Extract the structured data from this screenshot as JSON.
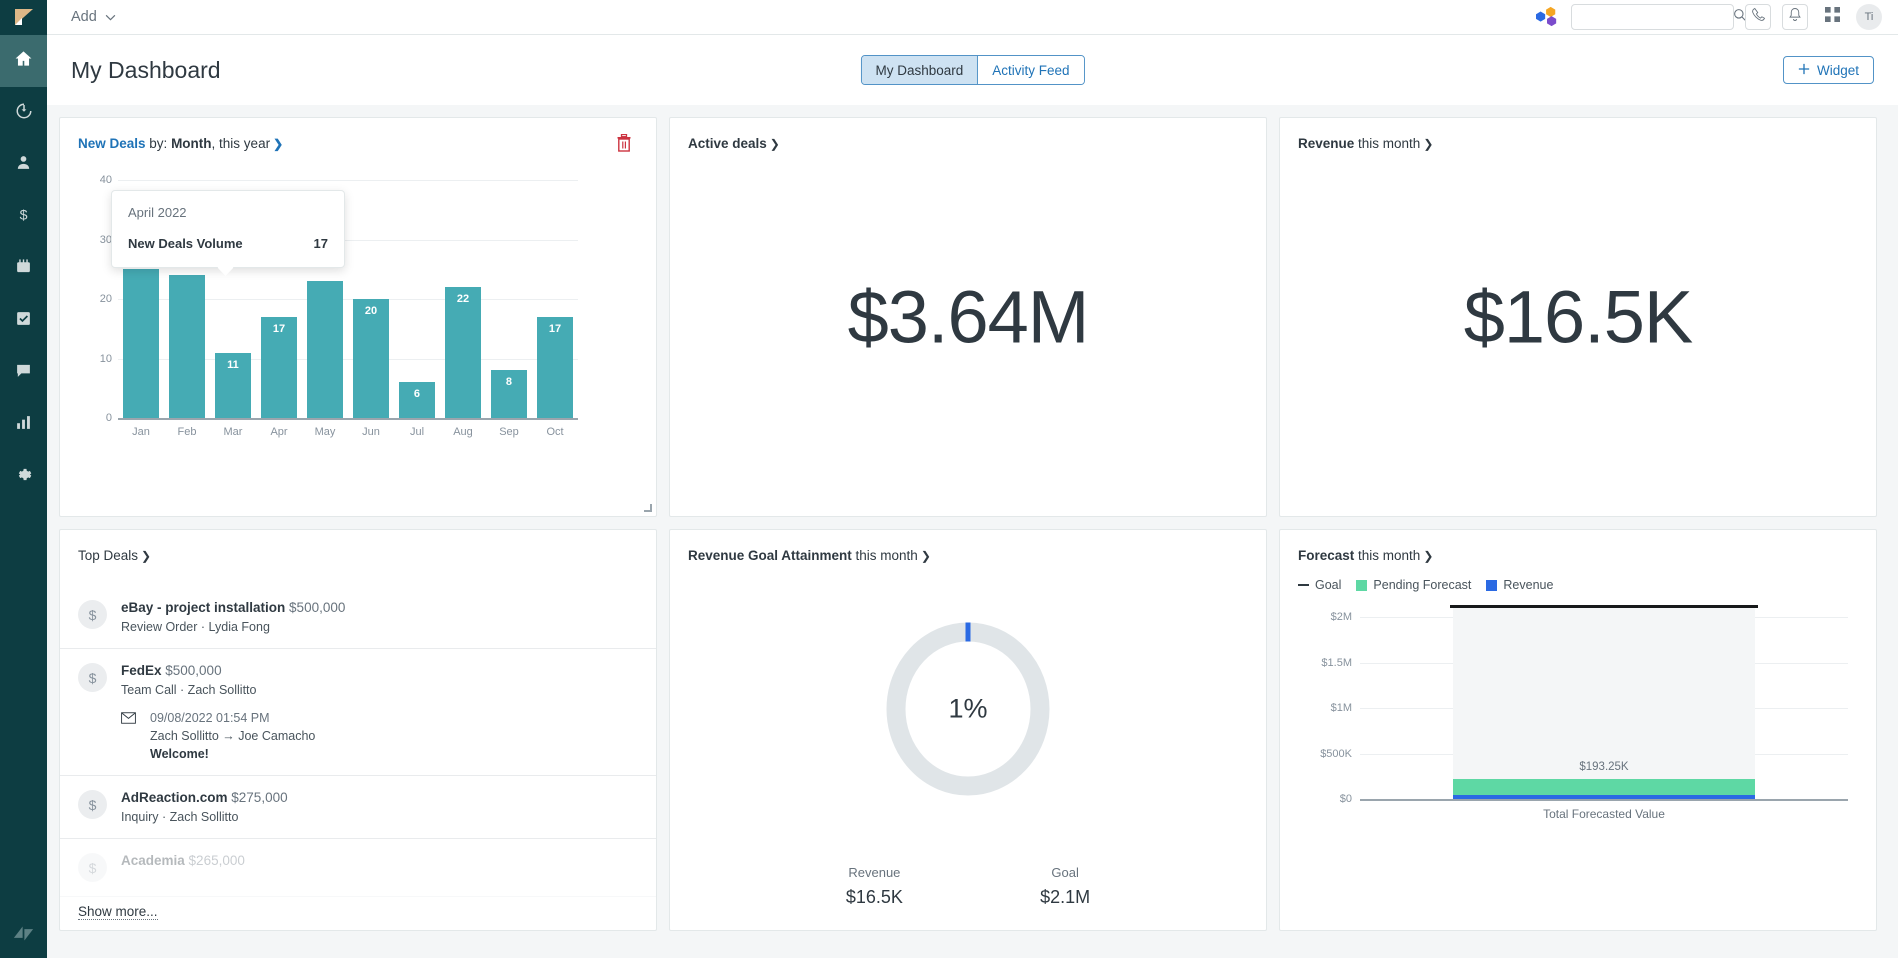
{
  "sidebar": {
    "brand_icon": "sell-logo-icon",
    "items": [
      {
        "name": "home",
        "icon": "home-icon",
        "active": true
      },
      {
        "name": "leads",
        "icon": "lead-icon",
        "active": false
      },
      {
        "name": "contacts",
        "icon": "person-icon",
        "active": false
      },
      {
        "name": "deals",
        "icon": "dollar-icon",
        "active": false
      },
      {
        "name": "calendar",
        "icon": "calendar-icon",
        "active": false
      },
      {
        "name": "tasks",
        "icon": "check-square-icon",
        "active": false
      },
      {
        "name": "communication",
        "icon": "chat-bubble-icon",
        "active": false
      },
      {
        "name": "reports",
        "icon": "bar-chart-icon",
        "active": false
      },
      {
        "name": "settings",
        "icon": "gear-icon",
        "active": false
      }
    ],
    "footer_logo": "zendesk-logo-icon"
  },
  "topbar": {
    "add_label": "Add",
    "add_caret_icon": "chevron-down-icon",
    "apps_icon": "integrations-icon",
    "search": {
      "value": "",
      "placeholder": "",
      "icon": "search-icon"
    },
    "call_icon": "phone-icon",
    "notifications_icon": "bell-icon",
    "grid_icon": "apps-grid-icon",
    "avatar_initials": "Ti"
  },
  "header": {
    "title": "My Dashboard",
    "tabs": [
      {
        "label": "My Dashboard",
        "active": true
      },
      {
        "label": "Activity Feed",
        "active": false
      }
    ],
    "widget_button": {
      "label": "Widget",
      "plus_icon": "plus-icon"
    }
  },
  "widgets": {
    "new_deals": {
      "title_link": "New Deals",
      "title_mid": " by: ",
      "title_strong": "Month",
      "title_tail": ", this year",
      "chevron": "❯",
      "delete_icon": "trash-icon",
      "resize_handle": "resize-handle-icon",
      "tooltip": {
        "date": "April 2022",
        "metric_label": "New Deals Volume",
        "metric_value": "17"
      }
    },
    "active_deals": {
      "title": "Active deals",
      "chevron": "❯",
      "value": "$3.64M"
    },
    "revenue": {
      "title_strong": "Revenue",
      "title_tail": " this month",
      "chevron": "❯",
      "value": "$16.5K"
    },
    "top_deals": {
      "title": "Top Deals",
      "chevron": "❯",
      "show_more": "Show more...",
      "rows": [
        {
          "avatar_icon": "dollar-icon",
          "name": "eBay - project installation",
          "amount": "$500,000",
          "sub": "Review Order · Lydia Fong",
          "faded": false,
          "note": null
        },
        {
          "avatar_icon": "dollar-icon",
          "name": "FedEx",
          "amount": "$500,000",
          "sub": "Team Call · Zach Sollitto",
          "faded": false,
          "note": {
            "icon": "envelope-icon",
            "time": "09/08/2022 01:54 PM",
            "people": "Zach Sollitto → Joe Camacho",
            "subject": "Welcome!"
          }
        },
        {
          "avatar_icon": "dollar-icon",
          "name": "AdReaction.com",
          "amount": "$275,000",
          "sub": "Inquiry · Zach Sollitto",
          "faded": false,
          "note": null
        },
        {
          "avatar_icon": "dollar-icon",
          "name": "Academia",
          "amount": "$265,000",
          "sub": "",
          "faded": true,
          "note": null
        }
      ]
    },
    "revenue_goal": {
      "title_strong": "Revenue Goal Attainment",
      "title_tail": " this month",
      "chevron": "❯",
      "percent": "1%",
      "legend": [
        {
          "label": "Revenue",
          "value": "$16.5K"
        },
        {
          "label": "Goal",
          "value": "$2.1M"
        }
      ]
    },
    "forecast": {
      "title_strong": "Forecast",
      "title_tail": " this month",
      "chevron": "❯"
    }
  },
  "chart_data": [
    {
      "id": "new-deals-bar",
      "type": "bar",
      "title": "New Deals by: Month, this year",
      "xlabel": "",
      "ylabel": "",
      "ylim": [
        0,
        40
      ],
      "yticks": [
        "0",
        "10",
        "20",
        "30",
        "40"
      ],
      "ytick_values": [
        0,
        10,
        20,
        30,
        40
      ],
      "grid": true,
      "bar_color": "#45abb4",
      "categories": [
        "Jan",
        "Feb",
        "Mar",
        "Apr",
        "May",
        "Jun",
        "Jul",
        "Aug",
        "Sep",
        "Oct"
      ],
      "values": [
        25,
        24,
        11,
        17,
        23,
        20,
        6,
        22,
        8,
        17
      ],
      "visible_labels": [
        "",
        "",
        "11",
        "17",
        "",
        "20",
        "6",
        "22",
        "8",
        "17"
      ],
      "highlighted_category": "Apr",
      "highlighted_value": 17
    },
    {
      "id": "revenue-goal-donut",
      "type": "pie",
      "title": "Revenue Goal Attainment this month",
      "center_label": "1%",
      "categories": [
        "Revenue",
        "Remaining"
      ],
      "values": [
        1,
        99
      ],
      "colors": [
        "#2b6ae3",
        "#e0e5e8"
      ],
      "legend_position": "bottom",
      "annotations": [
        {
          "label": "Revenue",
          "value": "$16.5K"
        },
        {
          "label": "Goal",
          "value": "$2.1M"
        }
      ]
    },
    {
      "id": "forecast-bar",
      "type": "bar",
      "title": "Forecast this month",
      "xlabel": "",
      "ylabel": "",
      "ylim": [
        0,
        2100000
      ],
      "yticks": [
        "$0",
        "$500K",
        "$1M",
        "$1.5M",
        "$2M"
      ],
      "ytick_values": [
        0,
        500000,
        1000000,
        1500000,
        2000000
      ],
      "grid": true,
      "legend_position": "top-left",
      "legend": [
        {
          "name": "Goal",
          "marker": "dash",
          "color": "#2f3941"
        },
        {
          "name": "Pending Forecast",
          "marker": "square",
          "color": "#5ed8a4"
        },
        {
          "name": "Revenue",
          "marker": "square",
          "color": "#2b6ae3"
        }
      ],
      "categories": [
        "Total Forecasted Value"
      ],
      "series": [
        {
          "name": "Pending Forecast",
          "values": [
            193250
          ],
          "color": "#5ed8a4"
        },
        {
          "name": "Revenue",
          "values": [
            16500
          ],
          "color": "#2b6ae3"
        },
        {
          "name": "Goal",
          "values": [
            2100000
          ],
          "color": "#2f3941"
        }
      ],
      "data_labels": [
        "$193.25K"
      ],
      "xtick_label": "Total Forecasted Value"
    }
  ],
  "colors": {
    "sidebar_bg": "#0d3d42",
    "sidebar_active": "#3b6b6e",
    "accent_link": "#1f73b7",
    "bar_teal": "#45abb4",
    "pending_green": "#5ed8a4",
    "revenue_blue": "#2b6ae3",
    "delete_red": "#cc3340",
    "page_bg": "#f4f6f7"
  }
}
